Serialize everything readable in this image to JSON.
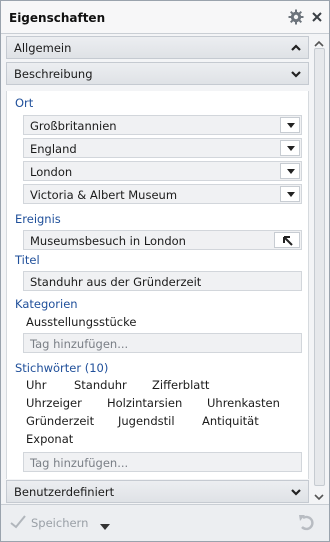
{
  "title_bar": {
    "title": "Eigenschaften"
  },
  "sections": {
    "allgemein": "Allgemein",
    "beschreibung": "Beschreibung",
    "benutzerdefiniert": "Benutzerdefiniert"
  },
  "ort": {
    "label": "Ort",
    "values": [
      "Großbritannien",
      "England",
      "London",
      "Victoria & Albert Museum"
    ]
  },
  "ereignis": {
    "label": "Ereignis",
    "value": "Museumsbesuch in London"
  },
  "titel": {
    "label": "Titel",
    "value": "Standuhr aus der Gründerzeit"
  },
  "kategorien": {
    "label": "Kategorien",
    "tags": [
      "Ausstellungsstücke"
    ],
    "placeholder": "Tag hinzufügen..."
  },
  "stichwoerter": {
    "label": "Stichwörter (10)",
    "tags": [
      "Uhr",
      "Standuhr",
      "Zifferblatt",
      "Uhrzeiger",
      "Holzintarsien",
      "Uhrenkasten",
      "Gründerzeit",
      "Jugendstil",
      "Antiquität",
      "Exponat"
    ],
    "placeholder": "Tag hinzufügen..."
  },
  "footer": {
    "save_label": "Speichern"
  },
  "icons": {
    "settings": "gear-icon",
    "close": "close-icon",
    "collapse": "chevron-up-icon",
    "expand": "chevron-down-icon",
    "dropdown": "triangle-down-icon",
    "open_event": "arrow-up-left-icon",
    "save": "checkmark-icon",
    "undo": "undo-icon"
  },
  "colors": {
    "section_label": "#1f4f9a",
    "header_bg": "#dfe2e6",
    "field_bg": "#f0f1f3"
  }
}
